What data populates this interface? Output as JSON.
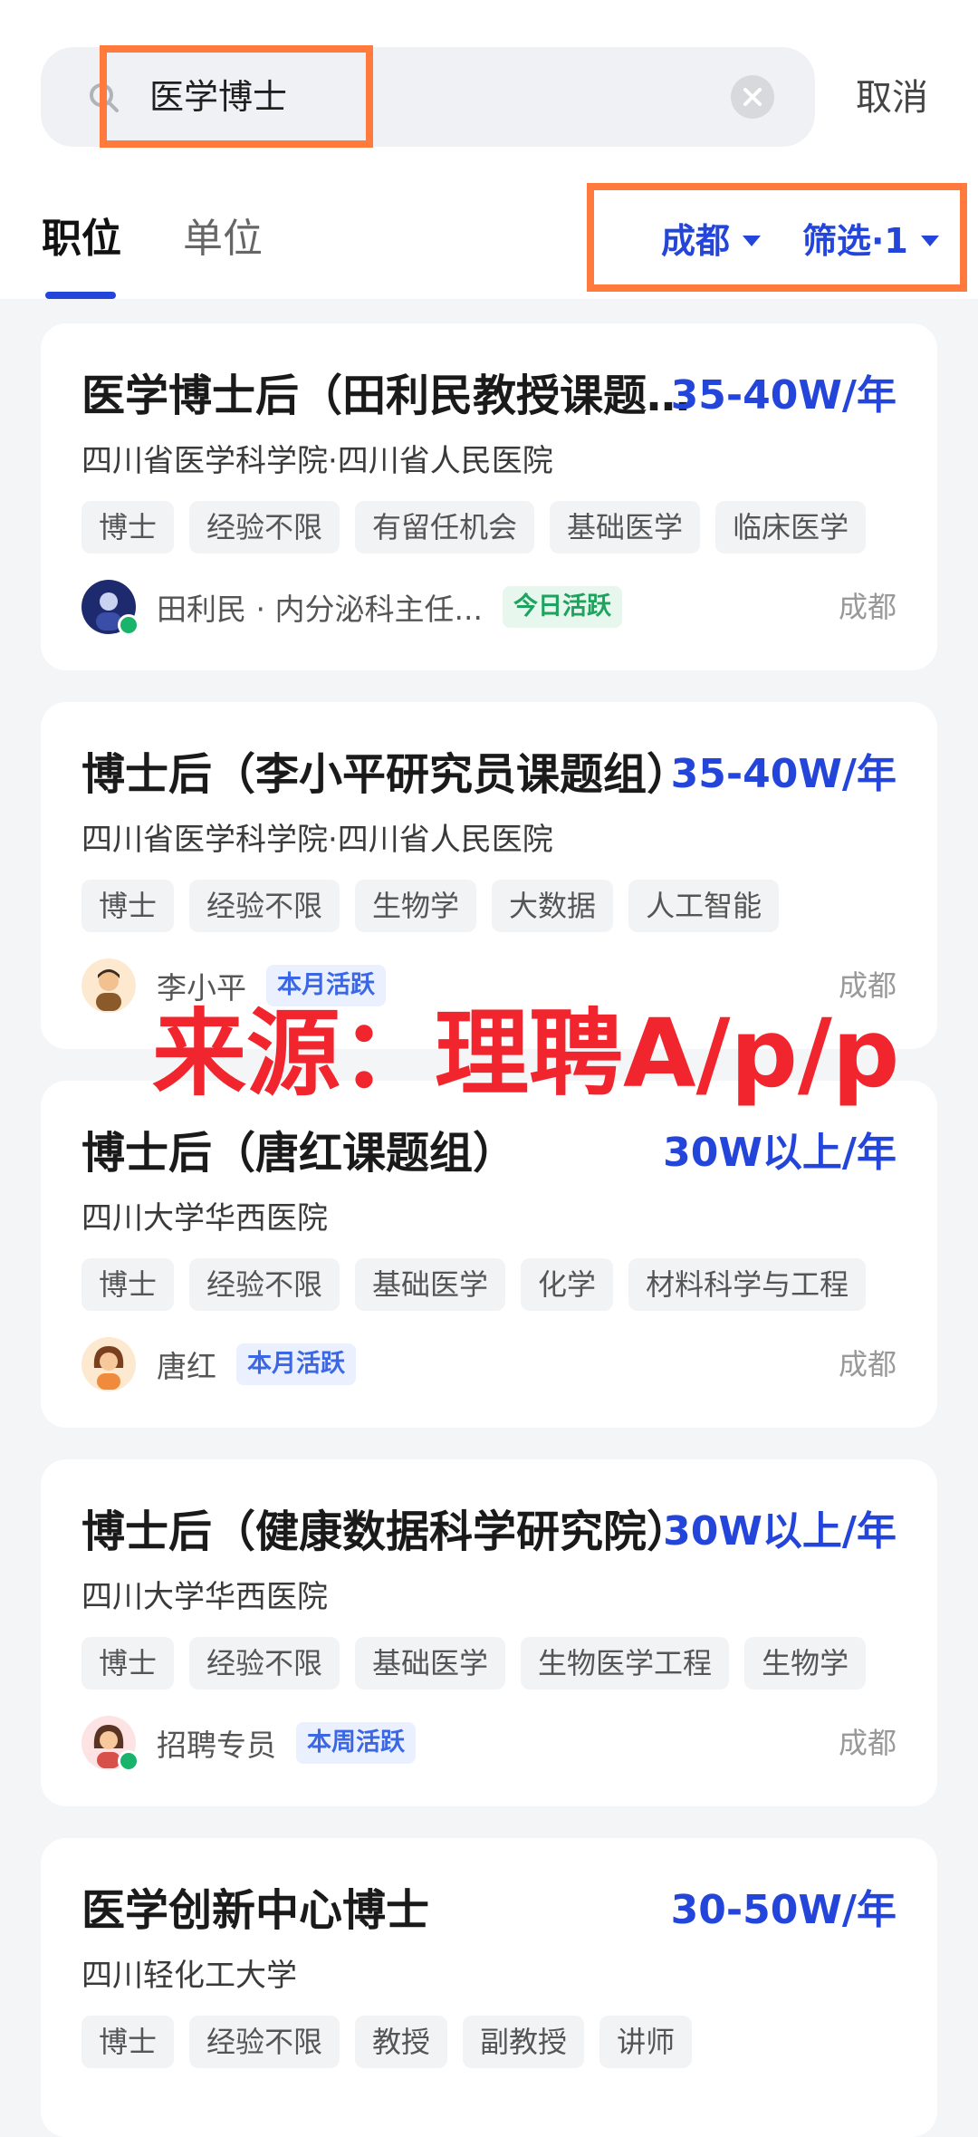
{
  "search": {
    "query": "医学博士",
    "cancel_label": "取消"
  },
  "tabs": [
    {
      "label": "职位",
      "active": true
    },
    {
      "label": "单位",
      "active": false
    }
  ],
  "filters": {
    "city_label": "成都",
    "filter_label": "筛选·1"
  },
  "colors": {
    "accent": "#2445d9",
    "highlight_box": "#ff7a3c",
    "watermark": "#f0252d"
  },
  "jobs": [
    {
      "title": "医学博士后（田利民教授课题组）",
      "salary": "35-40W/年",
      "company": "四川省医学科学院·四川省人民医院",
      "tags": [
        "博士",
        "经验不限",
        "有留任机会",
        "基础医学",
        "临床医学"
      ],
      "recruiter": "田利民 · 内分泌科主任...",
      "badge": "今日活跃",
      "online": true,
      "city": "成都"
    },
    {
      "title": "博士后（李小平研究员课题组）",
      "salary": "35-40W/年",
      "company": "四川省医学科学院·四川省人民医院",
      "tags": [
        "博士",
        "经验不限",
        "生物学",
        "大数据",
        "人工智能"
      ],
      "recruiter": "李小平",
      "badge": "本月活跃",
      "online": false,
      "city": "成都"
    },
    {
      "title": "博士后（唐红课题组）",
      "salary": "30W以上/年",
      "company": "四川大学华西医院",
      "tags": [
        "博士",
        "经验不限",
        "基础医学",
        "化学",
        "材料科学与工程"
      ],
      "recruiter": "唐红",
      "badge": "本月活跃",
      "online": false,
      "city": "成都"
    },
    {
      "title": "博士后（健康数据科学研究院）",
      "salary": "30W以上/年",
      "company": "四川大学华西医院",
      "tags": [
        "博士",
        "经验不限",
        "基础医学",
        "生物医学工程",
        "生物学"
      ],
      "recruiter": "招聘专员",
      "badge": "本周活跃",
      "online": true,
      "city": "成都"
    },
    {
      "title": "医学创新中心博士",
      "salary": "30-50W/年",
      "company": "四川轻化工大学",
      "tags": [
        "博士",
        "经验不限",
        "教授",
        "副教授",
        "讲师"
      ]
    }
  ],
  "watermark": "来源：理聘A/p/p"
}
